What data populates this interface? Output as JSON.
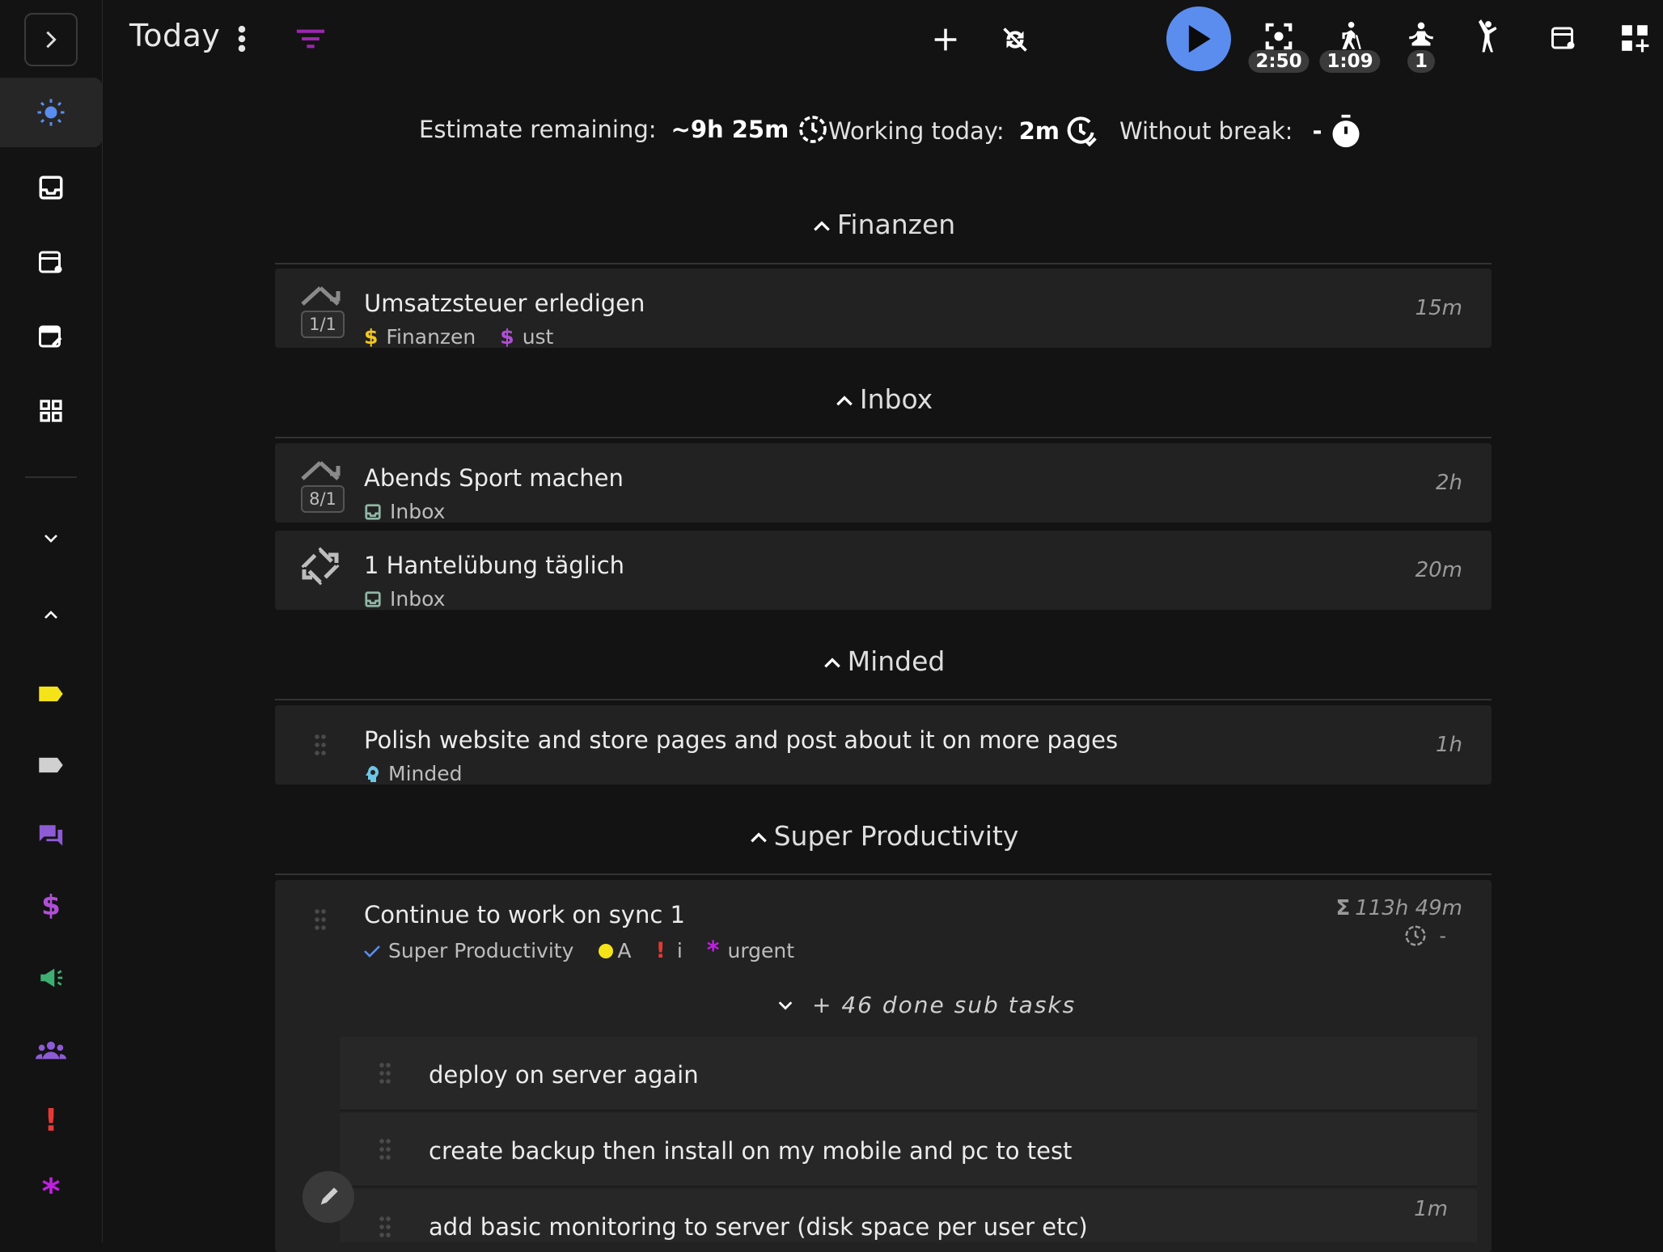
{
  "header": {
    "title": "Today",
    "badges": {
      "focus_timer": "2:50",
      "walk_timer": "1:09",
      "meditate_count": "1"
    }
  },
  "stats": {
    "estimate_label": "Estimate remaining:",
    "estimate_value": "~9h 25m",
    "working_label": "Working today:",
    "working_value": "2m",
    "break_label": "Without break:",
    "break_value": "-"
  },
  "groups": [
    {
      "title": "Finanzen",
      "tasks": [
        {
          "title": "Umsatzsteuer erledigen",
          "repeat_badge": "1/1",
          "tags": [
            {
              "icon": "$",
              "label": "Finanzen",
              "color": "#f3c623"
            },
            {
              "icon": "$",
              "label": "ust",
              "color": "#b04fd6"
            }
          ],
          "estimate": "15m"
        }
      ]
    },
    {
      "title": "Inbox",
      "tasks": [
        {
          "title": "Abends Sport machen",
          "repeat_badge": "8/1",
          "tags": [
            {
              "icon": "inbox-icon",
              "label": "Inbox",
              "color": "#8fb7a5"
            }
          ],
          "estimate": "2h"
        },
        {
          "title": "1 Hantelübung täglich",
          "tags": [
            {
              "icon": "inbox-icon",
              "label": "Inbox",
              "color": "#8fb7a5"
            }
          ],
          "estimate": "20m"
        }
      ]
    },
    {
      "title": "Minded",
      "tasks": [
        {
          "title": "Polish website and store pages and post about it on more pages",
          "tags": [
            {
              "icon": "head-icon",
              "label": "Minded",
              "color": "#6ec6e6"
            }
          ],
          "estimate": "1h"
        }
      ]
    },
    {
      "title": "Super Productivity",
      "tasks": [
        {
          "title": "Continue to work on sync 1",
          "tags": [
            {
              "icon": "check-icon",
              "label": "Super Productivity",
              "color": "#5b8def"
            },
            {
              "icon": "dot-icon",
              "label": "A",
              "color": "#f5e31a"
            },
            {
              "icon": "!",
              "label": "i",
              "color": "#e53935"
            },
            {
              "icon": "*",
              "label": "urgent",
              "color": "#c020e0"
            }
          ],
          "estimate": "113h 49m",
          "time_spent": "-"
        }
      ],
      "done_subtasks_label": "+ 46 done sub tasks",
      "subtasks": [
        {
          "title": "deploy on server again",
          "estimate": ""
        },
        {
          "title": "create backup then install on my mobile and pc to test",
          "estimate": ""
        },
        {
          "title": "add basic monitoring to server (disk space per user etc)",
          "estimate": "1m"
        }
      ]
    }
  ],
  "colors": {
    "accent": "#5b8def",
    "filter": "#9c27b0",
    "background": "#131313",
    "card": "#222222"
  }
}
